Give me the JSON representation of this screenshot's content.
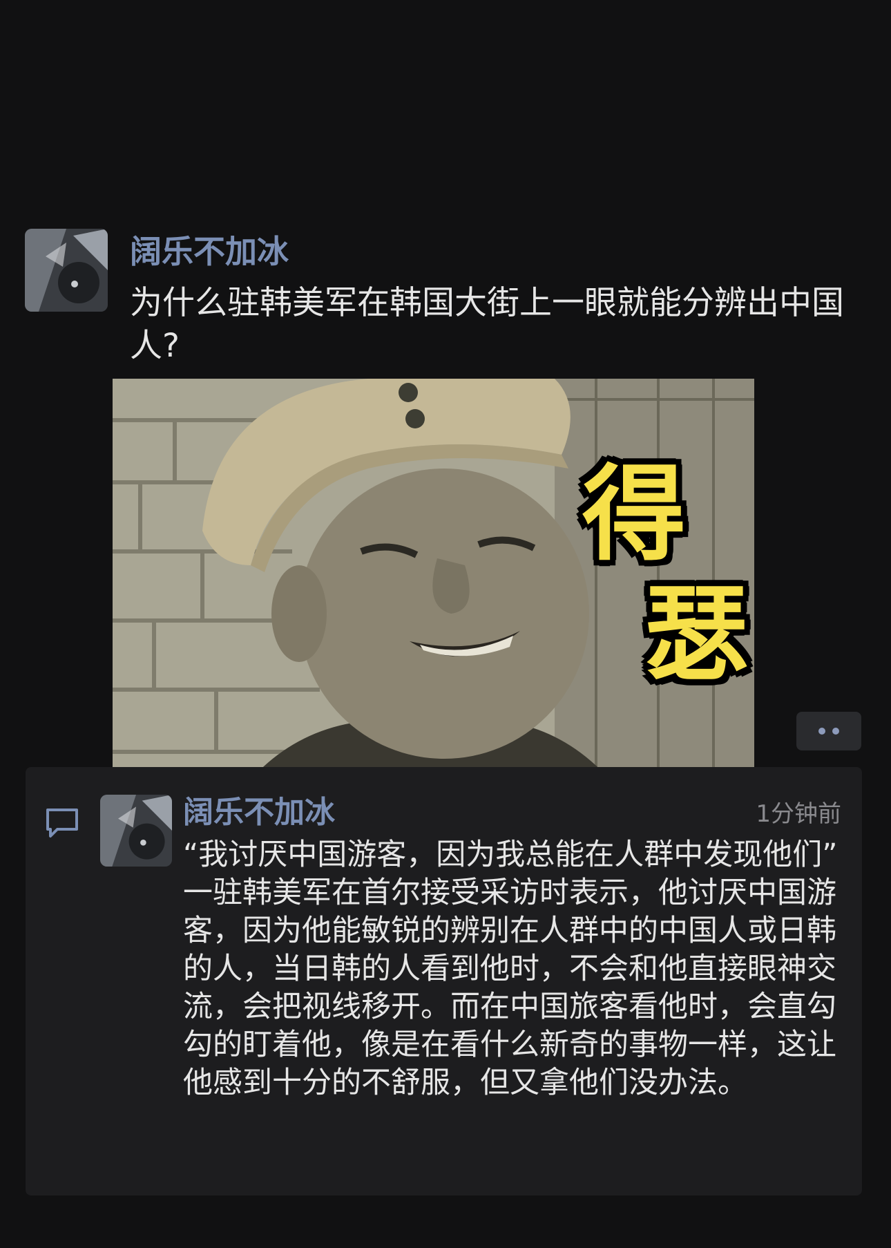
{
  "post": {
    "author": "阔乐不加冰",
    "text": "为什么驻韩美军在韩国大街上一眼就能分辨出中国人?",
    "image": {
      "caption_top": "得",
      "caption_bottom": "瑟"
    }
  },
  "more_button": {
    "icon": "more-dots-icon"
  },
  "comment": {
    "icon": "comment-bubble-icon",
    "author": "阔乐不加冰",
    "time": "1分钟前",
    "quote": "“我讨厌中国游客，因为我总能在人群中发现他们”",
    "body": "一驻韩美军在首尔接受采访时表示，他讨厌中国游客，因为他能敏锐的辨别在人群中的中国人或日韩的人，当日韩的人看到他时，不会和他直接眼神交流，会把视线移开。而在中国旅客看他时，会直勾勾的盯着他，像是在看什么新奇的事物一样，这让他感到十分的不舒服，但又拿他们没办法。"
  },
  "colors": {
    "background": "#111112",
    "author_name": "#7b8fb5",
    "body_text": "#e6e6e6",
    "comment_panel": "#1d1d1f",
    "caption": "#f6e04a"
  }
}
